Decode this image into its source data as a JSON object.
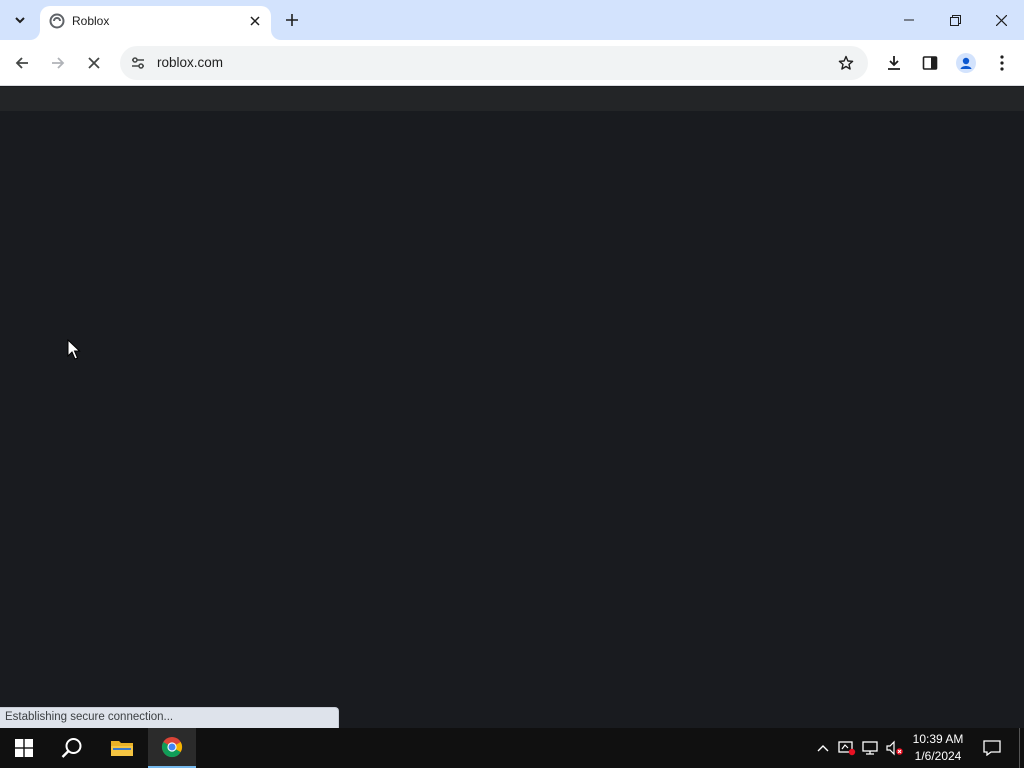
{
  "browser": {
    "tab": {
      "title": "Roblox"
    },
    "address_bar": {
      "url": "roblox.com"
    },
    "status_bubble": "Establishing secure connection..."
  },
  "icons": {
    "tab_search": "chevron-down-icon",
    "favicon": "roblox-favicon-icon",
    "tab_close": "close-icon",
    "new_tab": "plus-icon",
    "minimize": "minimize-icon",
    "restore": "restore-icon",
    "close_window": "close-icon",
    "back": "arrow-left-icon",
    "forward": "arrow-right-icon",
    "stop": "stop-loading-icon",
    "site_info": "tune-icon",
    "bookmark": "star-icon",
    "downloads": "download-icon",
    "side_panel": "side-panel-icon",
    "profile": "profile-icon",
    "menu": "kebab-menu-icon"
  },
  "taskbar": {
    "time": "10:39 AM",
    "date": "1/6/2024",
    "apps": [
      "start",
      "search",
      "file-explorer",
      "chrome"
    ]
  },
  "colors": {
    "tabstrip": "#d3e3fd",
    "page_background": "#191b1f",
    "taskbar": "#101010",
    "taskbar_active_underline": "#76b9ed"
  }
}
